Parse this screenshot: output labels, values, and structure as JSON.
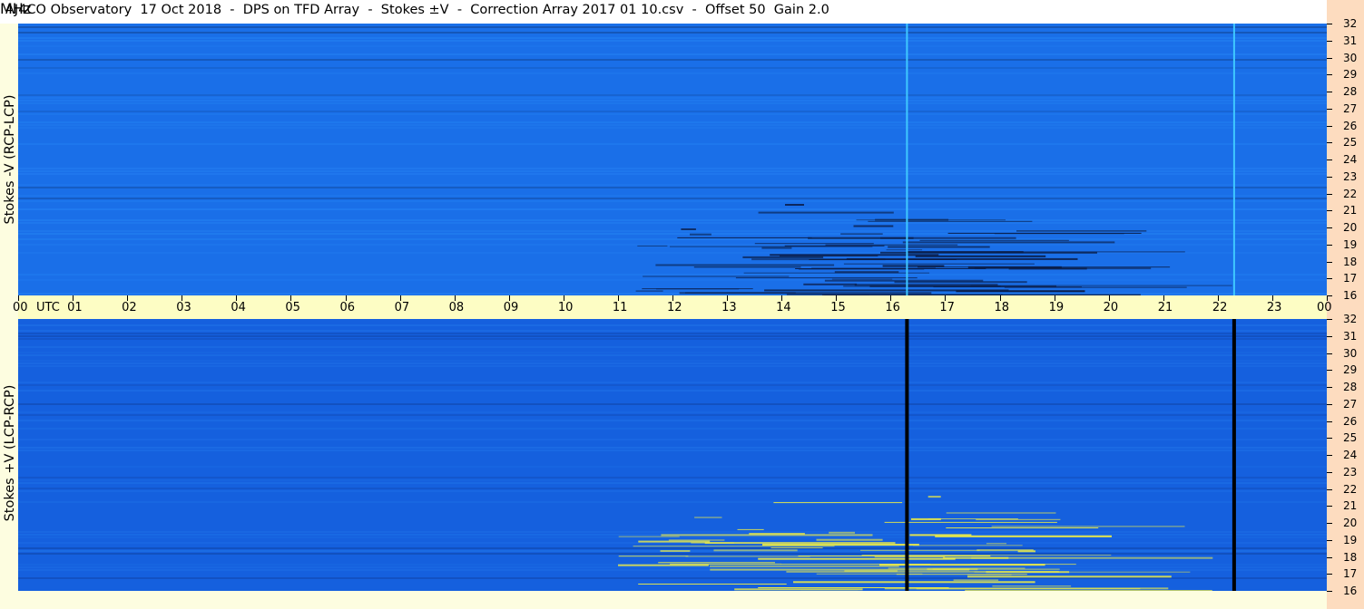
{
  "title": "AJ4CO Observatory  17 Oct 2018  -  DPS on TFD Array  -  Stokes ±V  -  Correction Array 2017 01 10.csv  -  Offset 50  Gain 2.0",
  "chart_data": [
    {
      "type": "heatmap",
      "name": "Stokes -V (RCP-LCP)",
      "ylabel": "Stokes -V (RCP-LCP)",
      "x_unit": "UTC",
      "x_ticks": [
        "00",
        "01",
        "02",
        "03",
        "04",
        "05",
        "06",
        "07",
        "08",
        "09",
        "10",
        "11",
        "12",
        "13",
        "14",
        "15",
        "16",
        "17",
        "18",
        "19",
        "20",
        "21",
        "22",
        "23",
        "00"
      ],
      "y_unit": "MHz",
      "y_ticks": [
        16,
        17,
        18,
        19,
        20,
        21,
        22,
        23,
        24,
        25,
        26,
        27,
        28,
        29,
        30,
        31,
        32
      ],
      "ylim": [
        16,
        32
      ],
      "xlim_hours": [
        0,
        24
      ],
      "colors": {
        "background": "#1a6fe8",
        "light": "#2f95ff",
        "dark": "#0a1e4a"
      },
      "vertical_lines_hours": [
        16.3,
        22.3
      ],
      "vertical_line_color": "#3fc8ff",
      "activity": {
        "start_hour": 11.0,
        "end_hour": 21.5,
        "freq_range_mhz": [
          16,
          22
        ],
        "color": "#0a1e4a"
      }
    },
    {
      "type": "heatmap",
      "name": "Stokes +V (LCP-RCP)",
      "ylabel": "Stokes +V (LCP-RCP)",
      "x_unit": "UTC",
      "x_ticks": [
        "00",
        "01",
        "02",
        "03",
        "04",
        "05",
        "06",
        "07",
        "08",
        "09",
        "10",
        "11",
        "12",
        "13",
        "14",
        "15",
        "16",
        "17",
        "18",
        "19",
        "20",
        "21",
        "22",
        "23",
        "00"
      ],
      "y_unit": "MHz",
      "y_ticks": [
        16,
        17,
        18,
        19,
        20,
        21,
        22,
        23,
        24,
        25,
        26,
        27,
        28,
        29,
        30,
        31,
        32
      ],
      "ylim": [
        16,
        32
      ],
      "xlim_hours": [
        0,
        24
      ],
      "colors": {
        "background": "#1560de",
        "light": "#2a85f2",
        "dark": "#0b2a78"
      },
      "vertical_lines_hours": [
        16.3,
        22.3
      ],
      "vertical_line_color": "#000000",
      "activity": {
        "start_hour": 11.0,
        "end_hour": 21.5,
        "freq_range_mhz": [
          16,
          22
        ],
        "color": "#e7e84a"
      }
    }
  ],
  "axis": {
    "utc_label": "UTC",
    "mhz_label": "MHz"
  }
}
